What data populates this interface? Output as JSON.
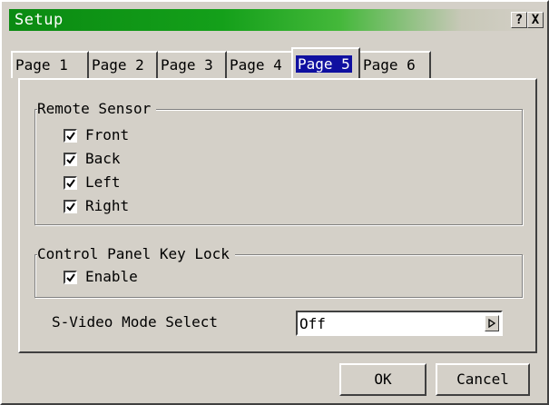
{
  "window": {
    "title": "Setup"
  },
  "titlebar": {
    "help_label": "?",
    "close_label": "X"
  },
  "tabs": [
    {
      "label": "Page 1",
      "active": false
    },
    {
      "label": "Page 2",
      "active": false
    },
    {
      "label": "Page 3",
      "active": false
    },
    {
      "label": "Page 4",
      "active": false
    },
    {
      "label": "Page 5",
      "active": true
    },
    {
      "label": "Page 6",
      "active": false
    }
  ],
  "remote_sensor": {
    "title": "Remote Sensor",
    "options": [
      {
        "label": "Front",
        "checked": true
      },
      {
        "label": "Back",
        "checked": true
      },
      {
        "label": "Left",
        "checked": true
      },
      {
        "label": "Right",
        "checked": true
      }
    ]
  },
  "control_panel_key_lock": {
    "title": "Control Panel Key Lock",
    "option": {
      "label": "Enable",
      "checked": true
    }
  },
  "svideo": {
    "label": "S-Video Mode Select",
    "value": "Off"
  },
  "buttons": {
    "ok": "OK",
    "cancel": "Cancel"
  },
  "colors": {
    "face": "#d4d0c8",
    "titlebar_green": "#0a8a12",
    "tab_highlight": "#1010a0"
  }
}
